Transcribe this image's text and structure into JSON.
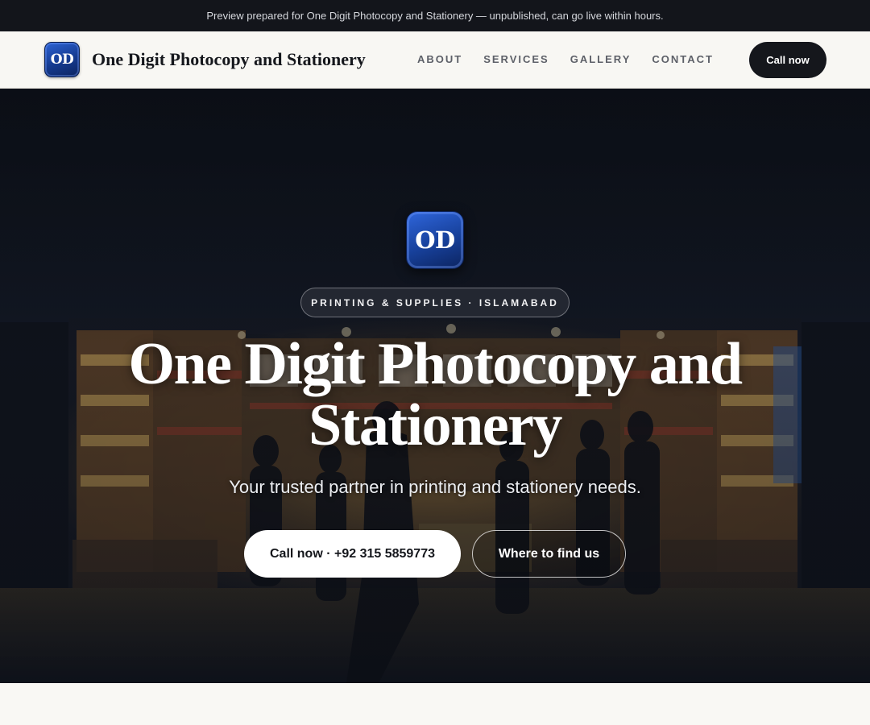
{
  "preview_banner": {
    "text": "Preview prepared for One Digit Photocopy and Stationery — unpublished, can go live within hours."
  },
  "nav": {
    "logo_text": "OD",
    "brand_name": "One Digit Photocopy and Stationery",
    "links": [
      "ABOUT",
      "SERVICES",
      "GALLERY",
      "CONTACT"
    ],
    "call_label": "Call now"
  },
  "hero": {
    "logo_text": "OD",
    "tagline": "PRINTING & SUPPLIES · ISLAMABAD",
    "title": "One Digit Photocopy and Stationery",
    "subtitle": "Your trusted partner in printing and stationery needs.",
    "primary_button": "Call now · +92 315 5859773",
    "secondary_button": "Where to find us"
  },
  "colors": {
    "banner_bg": "#13151b",
    "nav_bg": "#f8f7f3",
    "logo_blue": "#17409a",
    "dark_button": "#15171c",
    "hero_text": "#ffffff"
  }
}
